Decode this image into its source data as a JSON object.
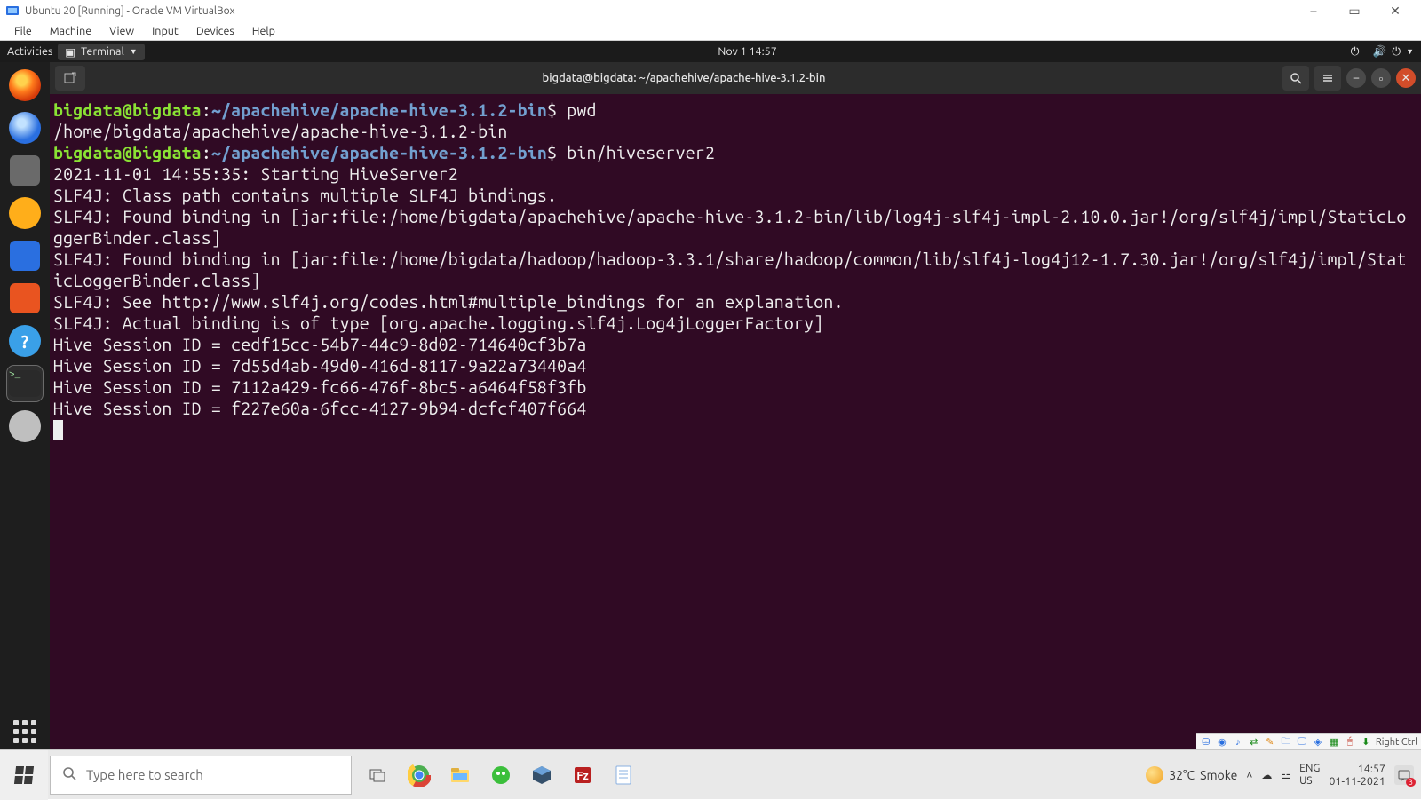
{
  "vbox": {
    "title": "Ubuntu 20 [Running] - Oracle VM VirtualBox",
    "menus": [
      "File",
      "Machine",
      "View",
      "Input",
      "Devices",
      "Help"
    ],
    "host_key": "Right Ctrl"
  },
  "ubuntu_top": {
    "activities": "Activities",
    "appname": "Terminal",
    "datetime": "Nov 1  14:57"
  },
  "dock": {
    "items": [
      {
        "name": "firefox",
        "label": "Firefox"
      },
      {
        "name": "thunderbird",
        "label": "Thunderbird"
      },
      {
        "name": "files",
        "label": "Files"
      },
      {
        "name": "rhythmbox",
        "label": "Rhythmbox"
      },
      {
        "name": "writer",
        "label": "LibreOffice Writer"
      },
      {
        "name": "software",
        "label": "Ubuntu Software"
      },
      {
        "name": "help",
        "label": "Help",
        "glyph": "?"
      },
      {
        "name": "terminal",
        "label": "Terminal",
        "glyph": ">_",
        "active": true
      },
      {
        "name": "cdrom",
        "label": "Optical Drive"
      }
    ],
    "apps": "Show Applications"
  },
  "terminal": {
    "header_title": "bigdata@bigdata: ~/apachehive/apache-hive-3.1.2-bin",
    "prompt_user": "bigdata@bigdata",
    "prompt_path": "~/apachehive/apache-hive-3.1.2-bin",
    "cmd1": "pwd",
    "out1": "/home/bigdata/apachehive/apache-hive-3.1.2-bin",
    "cmd2": "bin/hiveserver2",
    "out_lines": [
      "2021-11-01 14:55:35: Starting HiveServer2",
      "SLF4J: Class path contains multiple SLF4J bindings.",
      "SLF4J: Found binding in [jar:file:/home/bigdata/apachehive/apache-hive-3.1.2-bin/lib/log4j-slf4j-impl-2.10.0.jar!/org/slf4j/impl/StaticLoggerBinder.class]",
      "SLF4J: Found binding in [jar:file:/home/bigdata/hadoop/hadoop-3.3.1/share/hadoop/common/lib/slf4j-log4j12-1.7.30.jar!/org/slf4j/impl/StaticLoggerBinder.class]",
      "SLF4J: See http://www.slf4j.org/codes.html#multiple_bindings for an explanation.",
      "SLF4J: Actual binding is of type [org.apache.logging.slf4j.Log4jLoggerFactory]",
      "Hive Session ID = cedf15cc-54b7-44c9-8d02-714640cf3b7a",
      "Hive Session ID = 7d55d4ab-49d0-416d-8117-9a22a73440a4",
      "Hive Session ID = 7112a429-fc66-476f-8bc5-a6464f58f3fb",
      "Hive Session ID = f227e60a-6fcc-4127-9b94-dcfcf407f664"
    ]
  },
  "win": {
    "search_placeholder": "Type here to search",
    "weather_temp": "32°C",
    "weather_cond": "Smoke",
    "lang1": "ENG",
    "lang2": "US",
    "time": "14:57",
    "date": "01-11-2021",
    "notif_count": "3"
  }
}
